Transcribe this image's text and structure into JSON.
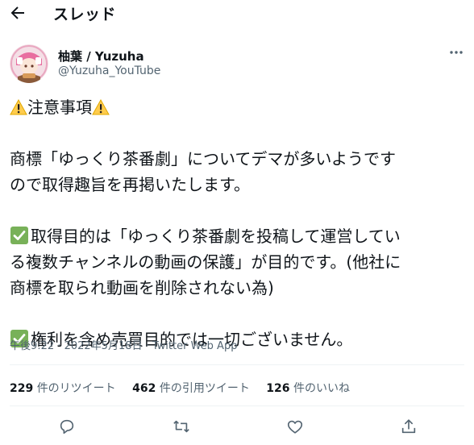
{
  "header": {
    "title": "スレッド",
    "back_icon": "arrow-left-icon"
  },
  "tweet": {
    "author_name": "柚葉 / Yuzuha",
    "author_handle": "@Yuzuha_YouTube",
    "lines": {
      "l1": "注意事項",
      "l2": "商標「ゆっくり茶番劇」についてデマが多いようです",
      "l3": "ので取得趣旨を再掲いたします。",
      "l4": "取得目的は「ゆっくり茶番劇を投稿して運営してい",
      "l5": "る複数チャンネルの動画の保護」が目的です。(他社に",
      "l6": "商標を取られ動画を削除されない為)",
      "l7": "権利を含め売買目的では一切ございません。"
    },
    "timestamp": "午後9:22 · 2022年5月18日 · Twitter Web App"
  },
  "stats": {
    "retweets_count": "229",
    "retweets_label": "件のリツイート",
    "quotes_count": "462",
    "quotes_label": "件の引用ツイート",
    "likes_count": "126",
    "likes_label": "件のいいね"
  },
  "icons": [
    "arrow-left-icon",
    "more-icon",
    "warning-icon",
    "check-icon",
    "reply-icon",
    "retweet-icon",
    "like-icon",
    "share-icon"
  ],
  "colors": {
    "text": "#0f1419",
    "secondary": "#536471",
    "divider": "#eff3f4",
    "check_green": "#78b159",
    "warning_yellow": "#ffcc4d"
  }
}
